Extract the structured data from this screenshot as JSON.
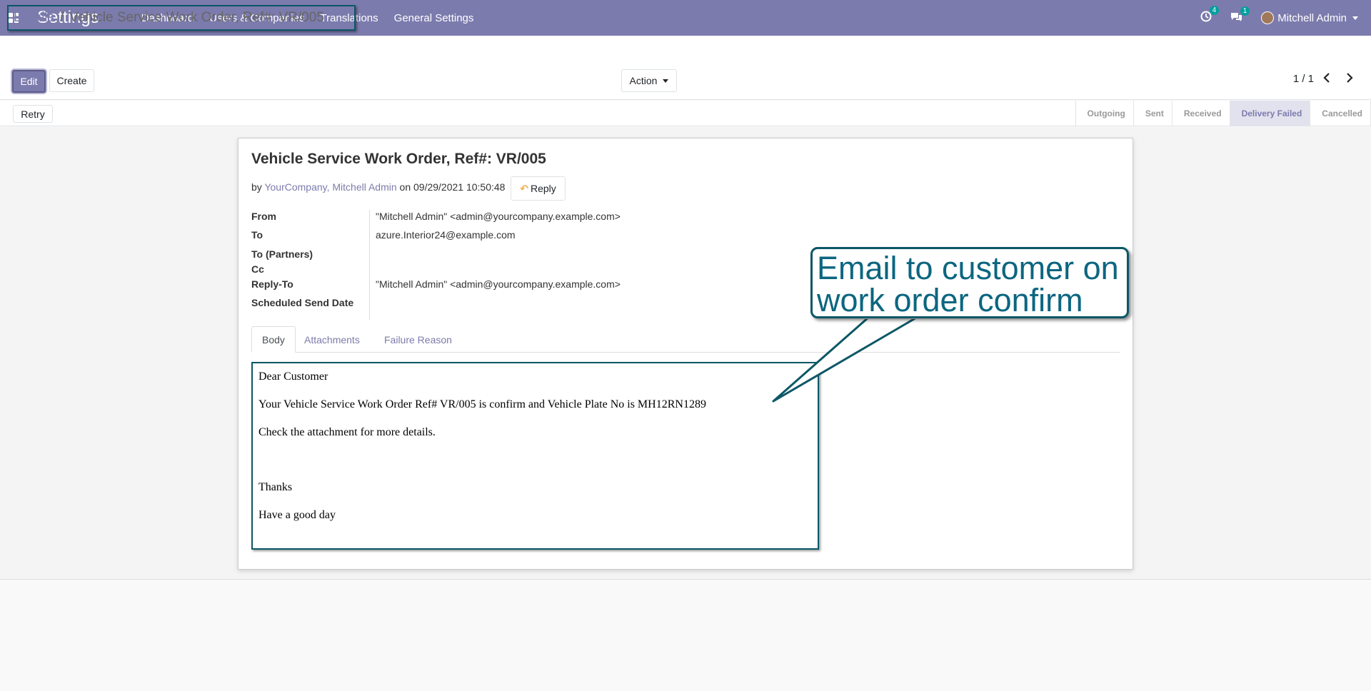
{
  "navbar": {
    "app_title": "Settings",
    "menu": [
      "Dashboard",
      "Users & Companies",
      "Translations",
      "General Settings"
    ],
    "activity_count": "4",
    "message_count": "1",
    "user_name": "Mitchell Admin"
  },
  "breadcrumb": {
    "parent": "Emails",
    "separator": "/",
    "current": "Vehicle Service Work Order, Ref#: VR/005"
  },
  "buttons": {
    "edit": "Edit",
    "create": "Create",
    "action": "Action",
    "retry": "Retry",
    "reply": "Reply"
  },
  "pager": {
    "value": "1 / 1"
  },
  "stages": [
    {
      "label": "Outgoing",
      "active": false
    },
    {
      "label": "Sent",
      "active": false
    },
    {
      "label": "Received",
      "active": false
    },
    {
      "label": "Delivery Failed",
      "active": true
    },
    {
      "label": "Cancelled",
      "active": false
    }
  ],
  "email": {
    "subject": "Vehicle Service Work Order, Ref#: VR/005",
    "by_prefix": "by",
    "authors": "YourCompany, Mitchell Admin",
    "date_text": "on 09/29/2021 10:50:48",
    "fields": [
      {
        "label": "From",
        "value": "\"Mitchell Admin\" <admin@yourcompany.example.com>"
      },
      {
        "label": "To",
        "value": "azure.Interior24@example.com"
      },
      {
        "label": "To (Partners)",
        "value": ""
      },
      {
        "label": "Cc",
        "value": ""
      },
      {
        "label": "Reply-To",
        "value": "\"Mitchell Admin\" <admin@yourcompany.example.com>"
      },
      {
        "label": "Scheduled Send Date",
        "value": ""
      }
    ],
    "tabs": [
      {
        "label": "Body",
        "active": true
      },
      {
        "label": "Attachments",
        "active": false
      },
      {
        "label": "Failure Reason",
        "active": false
      }
    ],
    "body_lines": [
      "Dear Customer",
      "Your Vehicle Service Work Order Ref# VR/005 is confirm and Vehicle Plate No is MH12RN1289",
      "Check the attachment for more details.",
      "Thanks",
      "Have a good day"
    ]
  },
  "callout": {
    "line1": "Email to customer on",
    "line2": "work order confirm"
  },
  "colors": {
    "brand": "#7c7bad",
    "annotation": "#0c5767",
    "accent_reply": "#f0ad4e"
  }
}
